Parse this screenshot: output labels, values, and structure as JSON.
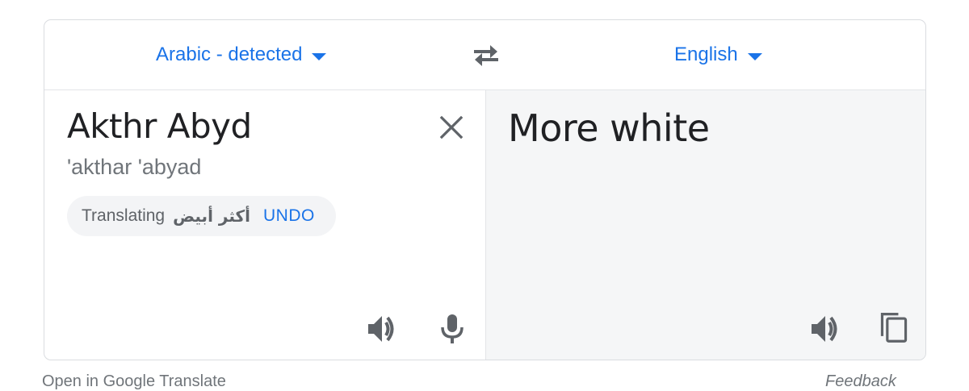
{
  "languages": {
    "source": "Arabic - detected",
    "target": "English"
  },
  "source": {
    "text": "Akthr Abyd",
    "transliteration": "'akthar 'abyad"
  },
  "chip": {
    "label": "Translating",
    "original": "أكثر أبيض",
    "undo": "UNDO"
  },
  "target": {
    "text": "More white"
  },
  "footer": {
    "open": "Open in Google Translate",
    "feedback": "Feedback"
  },
  "colors": {
    "accent": "#1a73e8",
    "icon": "#5f6368",
    "target_pane_bg": "#f5f6f7"
  }
}
